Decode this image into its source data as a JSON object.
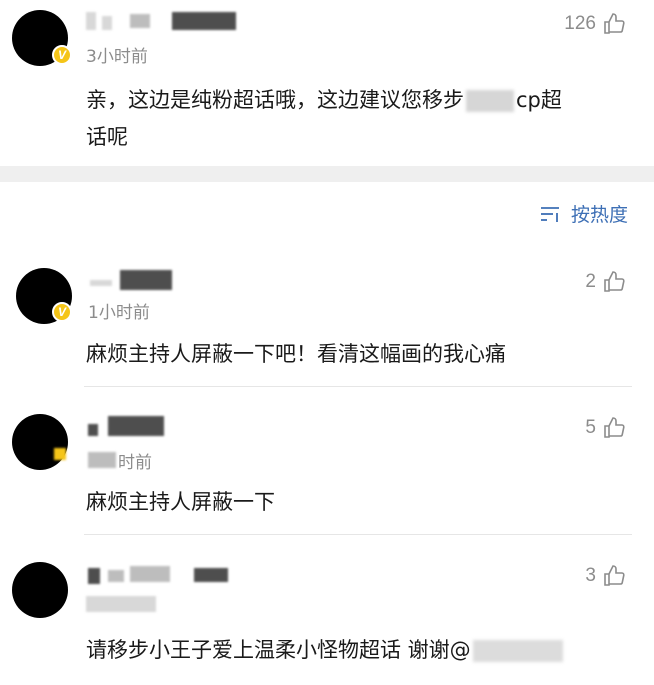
{
  "top_comment": {
    "time": "3小时前",
    "likes": "126",
    "text_part1": "亲，这边是纯粉超话哦，这边建议您移步",
    "text_part2": "cp超",
    "text_line2": "话呢"
  },
  "sort_button": {
    "label": "按热度",
    "icon": "sort-lines-icon"
  },
  "comments": [
    {
      "time": "1小时前",
      "likes": "2",
      "text": "麻烦主持人屏蔽一下吧！看清这幅画的我心痛"
    },
    {
      "time": "时前",
      "likes": "5",
      "text": "麻烦主持人屏蔽一下"
    },
    {
      "time": "",
      "likes": "3",
      "text_part1": "请移步小王子爱上温柔小怪物超话 谢谢@",
      "text_part2": ""
    }
  ],
  "colors": {
    "accent": "#3d6fb5",
    "badge": "#f5c518",
    "muted": "#8c8c8c"
  }
}
